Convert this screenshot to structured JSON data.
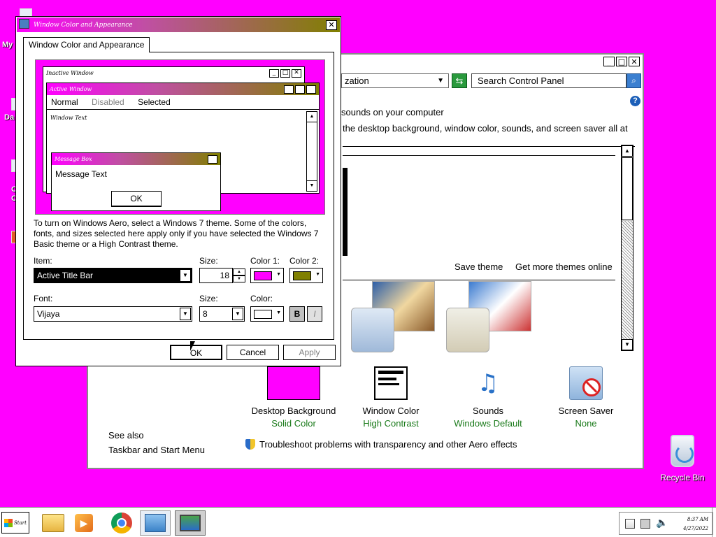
{
  "desktop": {
    "frag_my": "My",
    "frag_da": "Da",
    "frag_c1": "C",
    "frag_c2": "C",
    "recycle_bin": "Recycle Bin"
  },
  "colors": {
    "accent_magenta": "#ff00ff",
    "accent_olive": "#808000",
    "link_green": "#1a7a1a"
  },
  "control_panel": {
    "address_text": "zation",
    "search_placeholder": "Search Control Panel",
    "heading_partial": "sounds on your computer",
    "desc_partial": "the desktop background, window color, sounds, and screen saver all at",
    "save_theme": "Save theme",
    "get_more": "Get more themes online",
    "categories": [
      {
        "title": "Desktop Background",
        "sub": "Solid Color",
        "icon": "solid-color-swatch"
      },
      {
        "title": "Window Color",
        "sub": "High Contrast",
        "icon": "window-color-icon"
      },
      {
        "title": "Sounds",
        "sub": "Windows Default",
        "icon": "music-notes-icon"
      },
      {
        "title": "Screen Saver",
        "sub": "None",
        "icon": "screen-saver-none-icon"
      }
    ],
    "see_also": "See also",
    "taskbar_link": "Taskbar and Start Menu",
    "troubleshoot": "Troubleshoot problems with transparency and other Aero effects"
  },
  "dialog": {
    "title": "Window Color and Appearance",
    "tab": "Window Color and Appearance",
    "preview": {
      "inactive_title": "Inactive Window",
      "active_title": "Active Window",
      "menu_normal": "Normal",
      "menu_disabled": "Disabled",
      "menu_selected": "Selected",
      "window_text": "Window Text",
      "msgbox_title": "Message Box",
      "message_text": "Message Text",
      "ok": "OK"
    },
    "description": "To turn on Windows Aero, select a Windows 7 theme.  Some of the colors, fonts, and sizes selected here apply only if you have selected the Windows 7 Basic theme or a High Contrast theme.",
    "item_label": "Item:",
    "item_value": "Active Title Bar",
    "size_label": "Size:",
    "size_value": "18",
    "color1_label": "Color 1:",
    "color1_value": "#ff00ff",
    "color2_label": "Color 2:",
    "color2_value": "#808000",
    "font_label": "Font:",
    "font_value": "Vijaya",
    "font_size_label": "Size:",
    "font_size_value": "8",
    "font_color_label": "Color:",
    "font_color_value": "#ffffff",
    "bold": "B",
    "italic": "I",
    "ok": "OK",
    "cancel": "Cancel",
    "apply": "Apply"
  },
  "taskbar": {
    "start": "Start",
    "apps": [
      "file-explorer-icon",
      "media-player-icon",
      "chrome-icon",
      "control-panel-icon",
      "display-settings-icon"
    ],
    "clock_time": "8:37 AM",
    "clock_date": "4/27/2022"
  }
}
